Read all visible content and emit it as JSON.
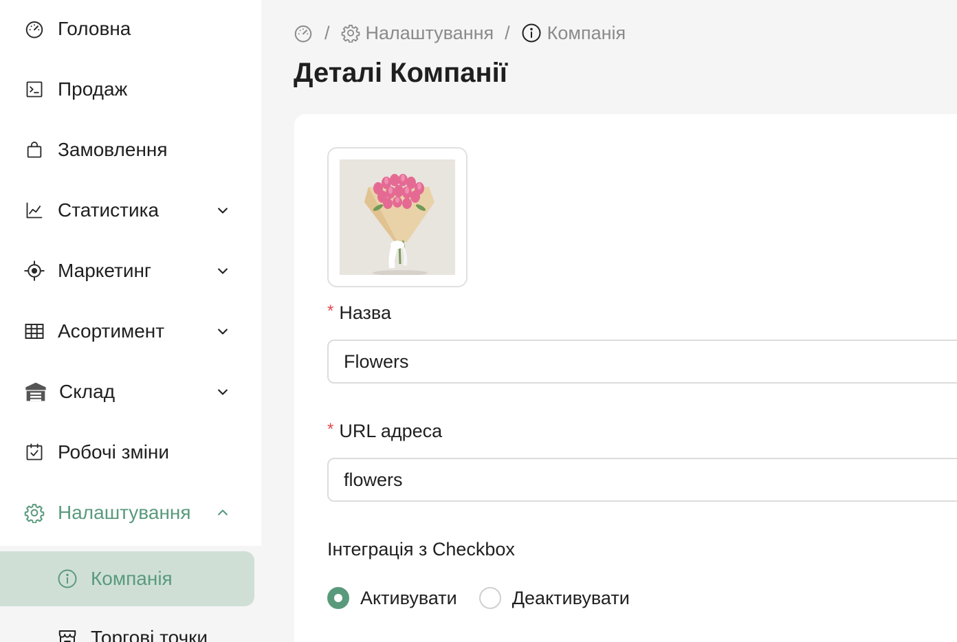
{
  "sidebar": {
    "items": [
      {
        "label": "Головна",
        "icon": "dashboard-icon"
      },
      {
        "label": "Продаж",
        "icon": "terminal-icon"
      },
      {
        "label": "Замовлення",
        "icon": "shopping-bag-icon"
      },
      {
        "label": "Статистика",
        "icon": "line-chart-icon",
        "expandable": true
      },
      {
        "label": "Маркетинг",
        "icon": "target-icon",
        "expandable": true
      },
      {
        "label": "Асортимент",
        "icon": "table-icon",
        "expandable": true
      },
      {
        "label": "Склад",
        "icon": "warehouse-icon",
        "expandable": true
      },
      {
        "label": "Робочі зміни",
        "icon": "calendar-check-icon"
      },
      {
        "label": "Налаштування",
        "icon": "gear-icon",
        "expandable": true,
        "expanded": true,
        "active": true
      }
    ],
    "subitems": [
      {
        "label": "Компанія",
        "icon": "info-icon",
        "selected": true
      },
      {
        "label": "Торгові точки",
        "icon": "store-icon"
      }
    ],
    "accent_color": "#5a9a7c",
    "selected_bg": "#cfdfd6"
  },
  "breadcrumb": {
    "home_icon": "dashboard-icon",
    "separator": "/",
    "settings_label": "Налаштування",
    "company_label": "Компанія"
  },
  "page": {
    "title": "Деталі Компанії"
  },
  "form": {
    "image_alt": "bouquet-photo",
    "name_required_mark": "*",
    "name_label": "Назва",
    "name_value": "Flowers",
    "url_required_mark": "*",
    "url_label": "URL адреса",
    "url_value": "flowers",
    "checkbox_integration_label": "Інтеграція з Checkbox",
    "radio_activate_label": "Активувати",
    "radio_deactivate_label": "Деактивувати",
    "radio_selected": "activate"
  }
}
